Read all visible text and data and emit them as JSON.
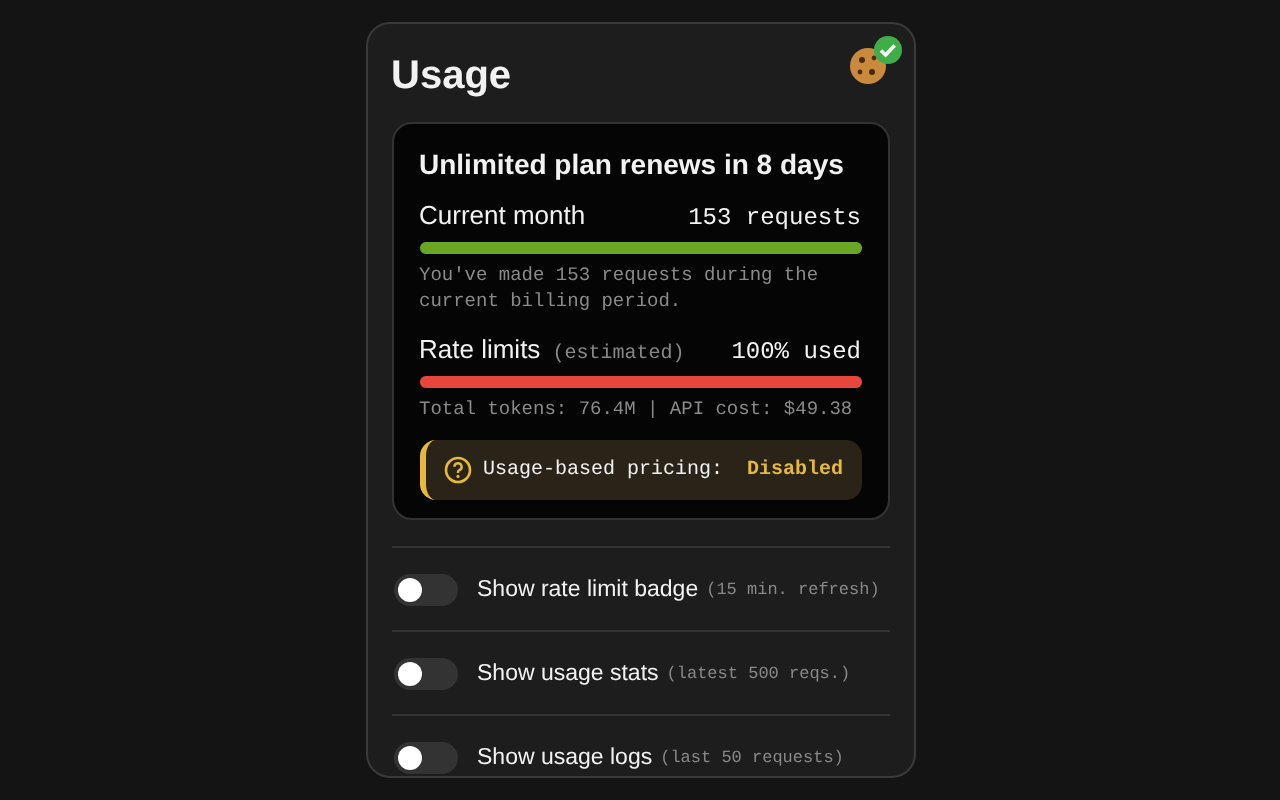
{
  "title": "Usage",
  "badge": {
    "checked": true
  },
  "plan": {
    "heading": "Unlimited plan renews in 8 days",
    "meters": [
      {
        "label": "Current month",
        "reading": "153 requests",
        "level": 1,
        "color": "#6aa624",
        "note": "You've made 153 requests during the current billing period."
      },
      {
        "label": "Rate limits",
        "qualifier": "(estimated)",
        "reading": "100% used",
        "level": 1,
        "color": "#e8453c",
        "note": "Total tokens: 76.4M | API cost: $49.38"
      }
    ],
    "pricing": {
      "label": "Usage-based pricing:",
      "value": "Disabled"
    }
  },
  "toggles": [
    {
      "label": "Show rate limit badge",
      "hint": "(15 min. refresh)",
      "on": false
    },
    {
      "label": "Show usage stats",
      "hint": "(latest 500 reqs.)",
      "on": false
    },
    {
      "label": "Show usage logs",
      "hint": "(last 50 requests)",
      "on": false
    }
  ]
}
